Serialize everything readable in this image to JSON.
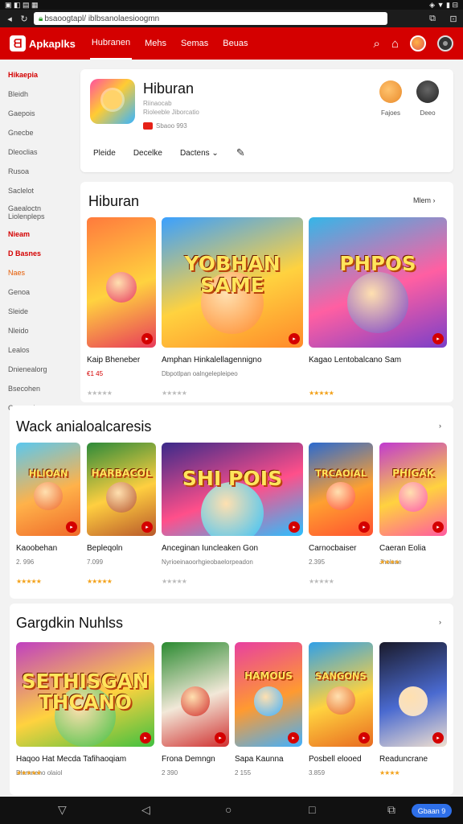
{
  "statusbar": {
    "left_icons": "▣ ◧ ▤ ▦",
    "right_icons": "◈ ▼ ▮ ⊟"
  },
  "browser": {
    "url": "bsaoogtapl/ iblbsanolaesioogmn",
    "tab_label": "⊡"
  },
  "app": {
    "brand": "Apkaplks",
    "nav": [
      "Hubranen",
      "Mehs",
      "Semas",
      "Beuas"
    ],
    "active_nav_index": 0
  },
  "sidebar": [
    {
      "label": "Hikaepia",
      "style": "red"
    },
    {
      "label": "Bleidh",
      "style": ""
    },
    {
      "label": "Gaepois",
      "style": ""
    },
    {
      "label": "Gnecbe",
      "style": ""
    },
    {
      "label": "Dleoclias",
      "style": ""
    },
    {
      "label": "Rusoa",
      "style": ""
    },
    {
      "label": "Saclelot",
      "style": ""
    },
    {
      "label": "Gaealoctn Liolenpleps",
      "style": "two"
    },
    {
      "label": "Nieam",
      "style": "red"
    },
    {
      "label": "D Basnes",
      "style": "red"
    },
    {
      "label": "Naes",
      "style": "orange"
    },
    {
      "label": "Genoa",
      "style": ""
    },
    {
      "label": "Sleide",
      "style": ""
    },
    {
      "label": "Nleido",
      "style": ""
    },
    {
      "label": "Lealos",
      "style": ""
    },
    {
      "label": "Dnienealorg",
      "style": ""
    },
    {
      "label": "Bsecohen",
      "style": ""
    },
    {
      "label": "Gonooci",
      "style": ""
    }
  ],
  "profile": {
    "title": "Hiburan",
    "sub1": "Riinaocab",
    "sub2": "Rioleeble Jiborcatio",
    "meta": "Sbaoo 993",
    "tabs": [
      "Pleide",
      "Decelke",
      "Dactens"
    ],
    "avatars": [
      {
        "label": "Fajoes"
      },
      {
        "label": "Deeo"
      }
    ]
  },
  "section1": {
    "title": "Hiburan",
    "more": "Mlem  ›",
    "cards": [
      {
        "title": "Kaip Bheneber",
        "meta": "€1 45",
        "stars": "★★★★★",
        "gold": false,
        "label": ""
      },
      {
        "title": "Amphan Hinkalellagennigno",
        "meta": "Dbpotlpan oalngelepleipeo",
        "stars": "★★★★★",
        "gold": false,
        "label": "YOBHAN SAME"
      },
      {
        "title": "Kagao Lentobalcano Sam",
        "meta": "",
        "stars": "★★★★★",
        "gold": true,
        "label": "PHPOS"
      }
    ]
  },
  "section2": {
    "title": "Wack anialoalcaresis",
    "more": "›",
    "cards": [
      {
        "title": "Kaoobehan",
        "meta": "2. 996",
        "stars": "★★★★★",
        "gold": true,
        "label": "HLIOAN"
      },
      {
        "title": "Bepleqoln",
        "meta": "7.099",
        "stars": "★★★★★",
        "gold": true,
        "label": "HARBACOL"
      },
      {
        "title": "Anceginan Iuncleaken Gon",
        "meta": "Nyrioeinaoorhgieobaelorpeadon",
        "stars": "★★★★★",
        "gold": false,
        "label": "SHI POIS"
      },
      {
        "title": "Carnocbaiser",
        "meta": "2.395",
        "stars": "★★★★★",
        "gold": false,
        "label": "TRCAOIAL"
      },
      {
        "title": "Caeran Eolia",
        "meta": "Jholsae",
        "stars": "★★★★",
        "gold": true,
        "label": "PHIGAK"
      }
    ]
  },
  "section3": {
    "title": "Gargdkin Nuhlss",
    "more": "›",
    "cards": [
      {
        "title": "Haqoo Hat Mecda Tafihaoqiam",
        "meta": "Dlamneho olaiol",
        "stars": "★★★★★",
        "gold": true,
        "label": "SETHISGAN THCANO"
      },
      {
        "title": "Frona Demngn",
        "meta": "2 390",
        "stars": "",
        "gold": false,
        "label": ""
      },
      {
        "title": "Sapa Kaunna",
        "meta": "2 155",
        "stars": "",
        "gold": false,
        "label": "HAMOUS"
      },
      {
        "title": "Posbell elooed",
        "meta": "3.859",
        "stars": "",
        "gold": false,
        "label": "SANGONS"
      },
      {
        "title": "Readuncrane",
        "meta": "",
        "stars": "★★★★",
        "gold": true,
        "label": ""
      }
    ]
  },
  "navbar": {
    "pill": "Gbaan 9"
  },
  "colors": {
    "brand_red": "#d40000",
    "star_gold": "#f3a21b"
  }
}
